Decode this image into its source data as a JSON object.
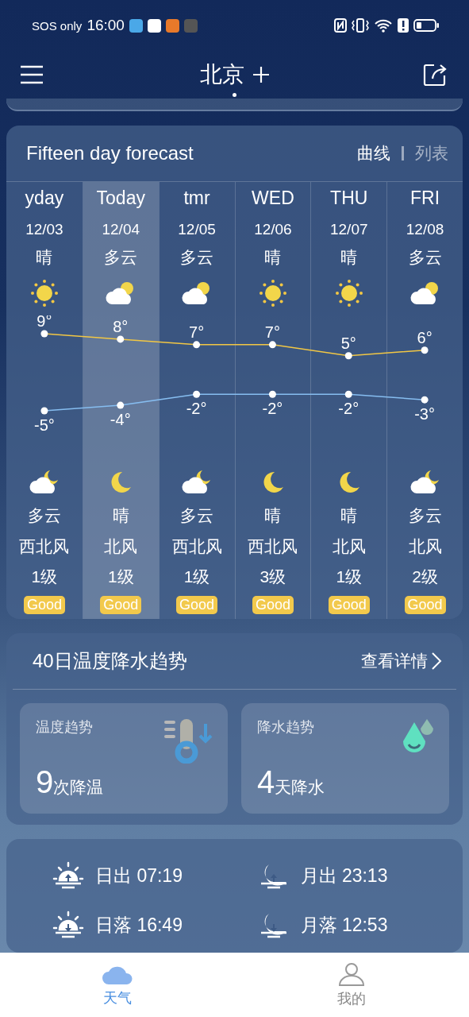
{
  "status_bar": {
    "carrier": "SOS only",
    "time": "16:00"
  },
  "header": {
    "city": "北京"
  },
  "forecast": {
    "title": "Fifteen day forecast",
    "view_toggle": [
      {
        "label": "曲线",
        "selected": true
      },
      {
        "label": "列表",
        "selected": false
      }
    ],
    "days": [
      {
        "name": "yday",
        "date": "12/03",
        "day": {
          "condition": "晴",
          "kind": "sun"
        },
        "night": {
          "condition": "多云",
          "kind": "moon_cloud"
        },
        "wind_dir": "西北风",
        "wind_level": "1级",
        "aqi": "Good",
        "selected": false
      },
      {
        "name": "Today",
        "date": "12/04",
        "day": {
          "condition": "多云",
          "kind": "sun_cloud"
        },
        "night": {
          "condition": "晴",
          "kind": "moon"
        },
        "wind_dir": "北风",
        "wind_level": "1级",
        "aqi": "Good",
        "selected": true
      },
      {
        "name": "tmr",
        "date": "12/05",
        "day": {
          "condition": "多云",
          "kind": "sun_cloud"
        },
        "night": {
          "condition": "多云",
          "kind": "moon_cloud"
        },
        "wind_dir": "西北风",
        "wind_level": "1级",
        "aqi": "Good",
        "selected": false
      },
      {
        "name": "WED",
        "date": "12/06",
        "day": {
          "condition": "晴",
          "kind": "sun"
        },
        "night": {
          "condition": "晴",
          "kind": "moon"
        },
        "wind_dir": "西北风",
        "wind_level": "3级",
        "aqi": "Good",
        "selected": false
      },
      {
        "name": "THU",
        "date": "12/07",
        "day": {
          "condition": "晴",
          "kind": "sun"
        },
        "night": {
          "condition": "晴",
          "kind": "moon"
        },
        "wind_dir": "北风",
        "wind_level": "1级",
        "aqi": "Good",
        "selected": false
      },
      {
        "name": "FRI",
        "date": "12/08",
        "day": {
          "condition": "多云",
          "kind": "sun_cloud"
        },
        "night": {
          "condition": "多云",
          "kind": "moon_cloud"
        },
        "wind_dir": "北风",
        "wind_level": "2级",
        "aqi": "Good",
        "selected": false
      }
    ],
    "chart_data": {
      "type": "line",
      "data_labels": true,
      "series": [
        {
          "color": "#f2c744",
          "marker": true,
          "values": [
            9,
            8,
            7,
            7,
            5,
            6
          ],
          "value_labels": [
            "9°",
            "8°",
            "7°",
            "7°",
            "5°",
            "6°"
          ]
        },
        {
          "color": "#86bdf0",
          "marker": true,
          "values": [
            -5,
            -4,
            -2,
            -2,
            -2,
            -3
          ],
          "value_labels": [
            "-5°",
            "-4°",
            "-2°",
            "-2°",
            "-2°",
            "-3°"
          ]
        }
      ]
    }
  },
  "trend": {
    "title": "40日温度降水趋势",
    "link": "查看详情",
    "cards": [
      {
        "kind": "temperature",
        "label": "温度趋势",
        "number": "9",
        "unit": "次降温"
      },
      {
        "kind": "rain",
        "label": "降水趋势",
        "number": "4",
        "unit": "天降水"
      }
    ]
  },
  "astro": [
    {
      "kind": "sunrise",
      "text": "日出 07:19"
    },
    {
      "kind": "moonrise",
      "text": "月出 23:13"
    },
    {
      "kind": "sunset",
      "text": "日落 16:49"
    },
    {
      "kind": "moonset",
      "text": "月落 12:53"
    }
  ],
  "bottom_nav": [
    {
      "kind": "weather",
      "label": "天气",
      "selected": true
    },
    {
      "kind": "profile",
      "label": "我的",
      "selected": false
    }
  ]
}
